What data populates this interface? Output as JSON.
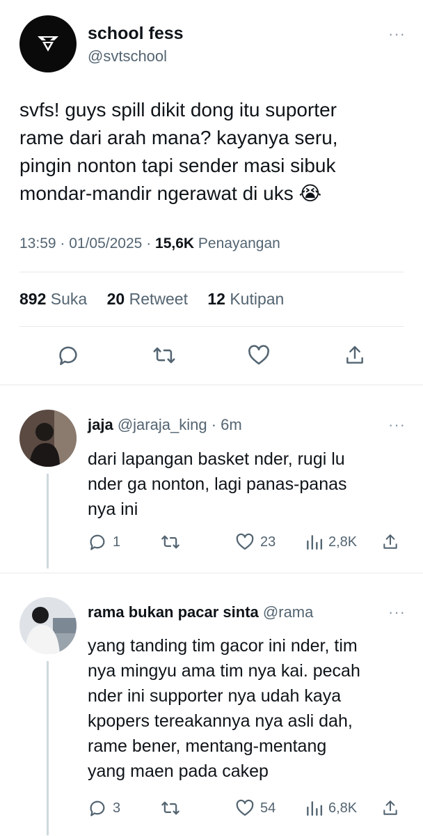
{
  "tweet": {
    "author_name": "school fess",
    "author_handle": "@svtschool",
    "text": "svfs! guys spill dikit dong itu suporter\nrame dari arah mana? kayanya seru,\npingin nonton tapi sender masi sibuk\nmondar-mandir ngerawat di uks 😭",
    "time": "13:59",
    "date": "01/05/2025",
    "views_count": "15,6K",
    "views_label": "Penayangan",
    "likes_count": "892",
    "likes_label": "Suka",
    "retweets_count": "20",
    "retweets_label": "Retweet",
    "quotes_count": "12",
    "quotes_label": "Kutipan",
    "more": "···"
  },
  "replies": [
    {
      "name": "jaja",
      "handle": "@jaraja_king",
      "age": "· 6m",
      "text": "dari lapangan basket nder, rugi lu\nnder ga nonton, lagi panas-panas\nnya ini",
      "reply_count": "1",
      "like_count": "23",
      "view_count": "2,8K",
      "more": "···"
    },
    {
      "name": "rama bukan pacar sinta",
      "handle": "@rama",
      "text": "yang tanding tim gacor ini nder, tim\nnya mingyu ama tim nya kai. pecah\nnder ini supporter nya udah kaya\nkpopers tereakannya nya asli dah,\nrame bener, mentang-mentang\nyang maen pada cakep",
      "reply_count": "3",
      "like_count": "54",
      "view_count": "6,8K",
      "more": "···"
    }
  ],
  "icons": [
    "reply-icon",
    "retweet-icon",
    "like-icon",
    "share-icon",
    "views-icon",
    "more-icon"
  ],
  "colors": {
    "text": "#0f1419",
    "secondary": "#536471",
    "divider": "#e7e9ea"
  }
}
